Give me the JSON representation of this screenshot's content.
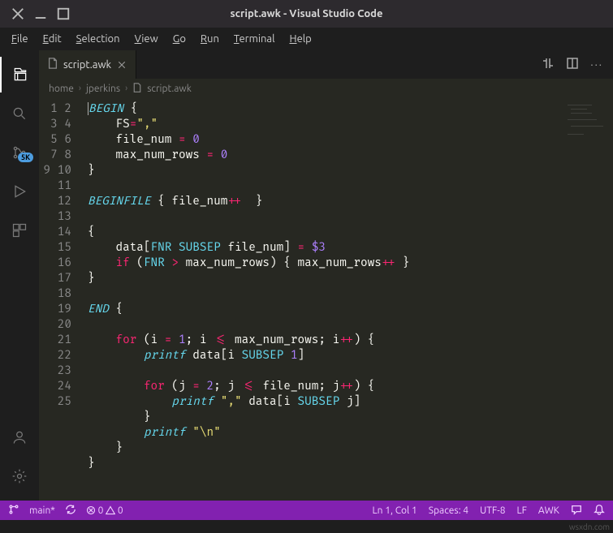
{
  "title": "script.awk - Visual Studio Code",
  "menu": [
    "File",
    "Edit",
    "Selection",
    "View",
    "Go",
    "Run",
    "Terminal",
    "Help"
  ],
  "activity": {
    "scm_badge": "5K"
  },
  "tab": {
    "label": "script.awk"
  },
  "breadcrumbs": [
    "home",
    "jperkins",
    "script.awk"
  ],
  "editor": {
    "lines": 25
  },
  "status": {
    "branch": "main*",
    "errors": "0",
    "warnings": "0",
    "lncol": "Ln 1, Col 1",
    "spaces": "Spaces: 4",
    "encoding": "UTF-8",
    "eol": "LF",
    "lang": "AWK"
  },
  "watermark": "wsxdn.com"
}
